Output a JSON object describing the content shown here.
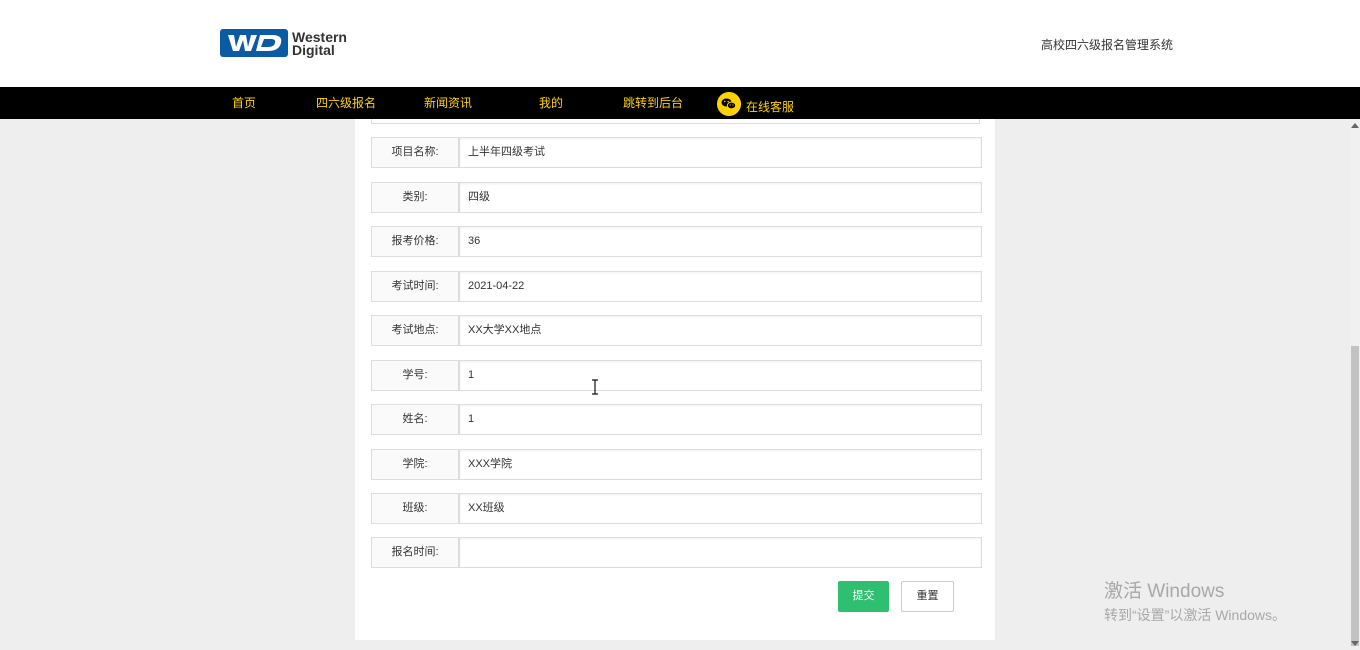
{
  "header": {
    "logo_text": [
      "Western",
      "Digital"
    ],
    "site_title": "高校四六级报名管理系统"
  },
  "nav": {
    "items": [
      "首页",
      "四六级报名",
      "新闻资讯",
      "我的",
      "跳转到后台"
    ],
    "service_label": "在线客服"
  },
  "form": {
    "fields": [
      {
        "label": "项目名称:",
        "value": "上半年四级考试"
      },
      {
        "label": "类别:",
        "value": "四级"
      },
      {
        "label": "报考价格:",
        "value": "36"
      },
      {
        "label": "考试时间:",
        "value": "2021-04-22"
      },
      {
        "label": "考试地点:",
        "value": "XX大学XX地点"
      },
      {
        "label": "学号:",
        "value": "1"
      },
      {
        "label": "姓名:",
        "value": "1"
      },
      {
        "label": "学院:",
        "value": "XXX学院"
      },
      {
        "label": "班级:",
        "value": "XX班级"
      },
      {
        "label": "报名时间:",
        "value": ""
      }
    ],
    "submit_label": "提交",
    "reset_label": "重置"
  },
  "activation": {
    "line1": "激活 Windows",
    "line2": "转到“设置”以激活 Windows。"
  },
  "colors": {
    "nav_bg": "#000000",
    "nav_text": "#ffd200",
    "submit_bg": "#2fbf71",
    "page_bg": "#eeeeee"
  }
}
